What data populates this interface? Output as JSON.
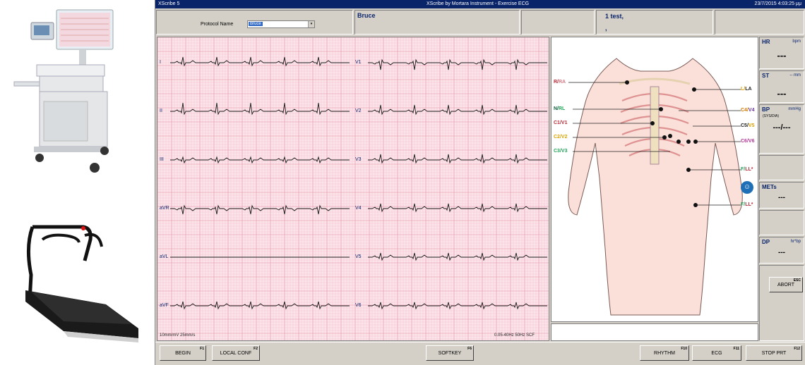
{
  "window": {
    "app_title": "XScribe 5",
    "center_title": "XScribe by Mortara Instrument - Exercise ECG",
    "datetime": "23/7/2015 4:03:25 μμ"
  },
  "header": {
    "protocol_label": "Protocol Name",
    "protocol_value": "Bruce",
    "protocol_display": "Bruce",
    "patient_line1": "1  test,",
    "patient_line2": ","
  },
  "ecg": {
    "leads_left": [
      "I",
      "II",
      "III",
      "aVR",
      "aVL",
      "aVF"
    ],
    "leads_right": [
      "V1",
      "V2",
      "V3",
      "V4",
      "V5",
      "V6"
    ],
    "footer_left": "10mm/mV  25mm/s",
    "footer_right": "0.05-40Hz  50Hz  SCF"
  },
  "electrodes": {
    "left_side": [
      {
        "a": "R/",
        "b": "RA",
        "color_a": "#b52d3a",
        "color_b": "#d87a86"
      },
      {
        "a": "N/",
        "b": "RL",
        "color_a": "#0f5e3c",
        "color_b": "#25a35b"
      },
      {
        "a": "C1/",
        "b": "V1",
        "color_a": "#b52d3a",
        "color_b": "#b52d3a"
      },
      {
        "a": "C2/",
        "b": "V2",
        "color_a": "#d9a400",
        "color_b": "#d9a400"
      },
      {
        "a": "C3/",
        "b": "V3",
        "color_a": "#25a35b",
        "color_b": "#25a35b"
      }
    ],
    "right_side": [
      {
        "a": "L/",
        "b": "LA",
        "color_a": "#e0a000",
        "color_b": "#222222"
      },
      {
        "a": "C4/",
        "b": "V4",
        "color_a": "#d27a00",
        "color_b": "#6b3aa0"
      },
      {
        "a": "C5/",
        "b": "V5",
        "color_a": "#222222",
        "color_b": "#e0a000"
      },
      {
        "a": "C6/",
        "b": "V6",
        "color_a": "#b23a9a",
        "color_b": "#b23a9a"
      },
      {
        "a": "F/",
        "b": "LL*",
        "color_a": "#25a35b",
        "color_b": "#b52d3a"
      },
      {
        "a": "F/",
        "b": "LL*",
        "color_a": "#25a35b",
        "color_b": "#b52d3a"
      }
    ]
  },
  "vitals": {
    "hr": {
      "label": "HR",
      "unit": "bpm",
      "value": "---"
    },
    "st": {
      "label": "ST",
      "unit": "--  mm",
      "value": "---"
    },
    "bp": {
      "label": "BP",
      "unit": "mmHg",
      "sub": "(SYS/DIA)",
      "value": "---/---"
    },
    "mets": {
      "label": "METs",
      "value": "---"
    },
    "dp": {
      "label": "DP",
      "unit": "hr*bp",
      "value": "---"
    },
    "abort": {
      "label": "ABORT",
      "key": "ESC"
    }
  },
  "buttons": {
    "begin": {
      "label": "BEGIN",
      "key": "F1"
    },
    "local_conf": {
      "label": "LOCAL CONF",
      "key": "F2"
    },
    "softkey": {
      "label": "SOFTKEY",
      "key": "F6"
    },
    "rhythm": {
      "label": "RHYTHM",
      "key": "F10"
    },
    "ecg": {
      "label": "ECG",
      "key": "F11"
    },
    "stop_prt": {
      "label": "STOP PRT",
      "key": "F12"
    }
  },
  "colors": {
    "title_bar": "#0a246a",
    "ecg_grid_bg": "#fbe4ea",
    "ecg_grid_line": "#f2b7c4",
    "ecg_trace": "#1a1a1a",
    "window_bg": "#d4d0c8"
  }
}
